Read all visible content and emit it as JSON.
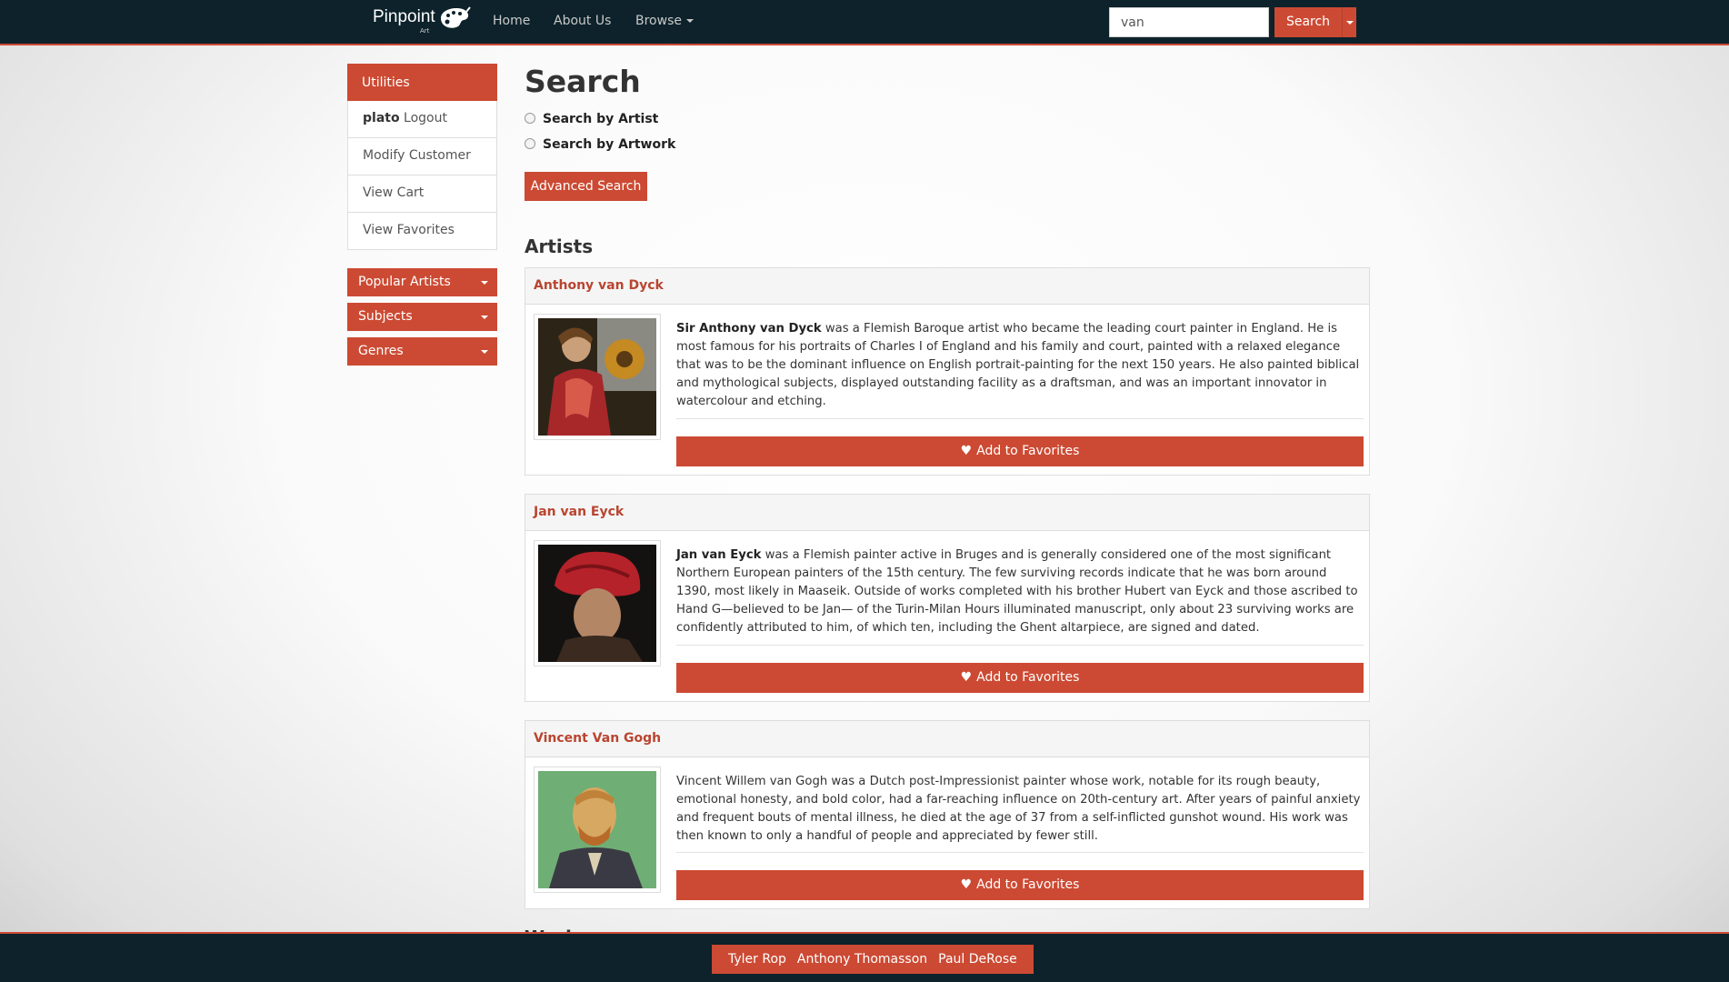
{
  "navbar": {
    "brand": "Pinpoint",
    "brand_sub": "Art",
    "links": [
      "Home",
      "About Us",
      "Browse"
    ],
    "search_value": "van",
    "search_button": "Search"
  },
  "sidebar": {
    "utilities_label": "Utilities",
    "user_name": "plato",
    "logout_label": "Logout",
    "items": [
      "Modify Customer",
      "View Cart",
      "View Favorites"
    ],
    "dropdowns": [
      "Popular Artists",
      "Subjects",
      "Genres"
    ]
  },
  "main": {
    "title": "Search",
    "radios": [
      "Search by Artist",
      "Search by Artwork"
    ],
    "advanced_button": "Advanced Search",
    "artists_heading": "Artists",
    "next_heading": "Works",
    "favorite_label": "Add to Favorites",
    "artists": [
      {
        "name": "Anthony van Dyck",
        "bold": "Sir Anthony van Dyck",
        "text": " was a Flemish Baroque artist who became the leading court painter in England. He is most famous for his portraits of Charles I of England and his family and court, painted with a relaxed elegance that was to be the dominant influence on English portrait-painting for the next 150 years. He also painted biblical and mythological subjects, displayed outstanding facility as a draftsman, and was an important innovator in watercolour and etching."
      },
      {
        "name": "Jan van Eyck",
        "bold": "Jan van Eyck",
        "text": " was a Flemish painter active in Bruges and is generally considered one of the most significant Northern European painters of the 15th century. The few surviving records indicate that he was born around 1390, most likely in Maaseik. Outside of works completed with his brother Hubert van Eyck and those ascribed to Hand G—believed to be Jan— of the Turin-Milan Hours illuminated manuscript, only about 23 surviving works are confidently attributed to him, of which ten, including the Ghent altarpiece, are signed and dated."
      },
      {
        "name": "Vincent Van Gogh",
        "bold": "",
        "text": "Vincent Willem van Gogh was a Dutch post-Impressionist painter whose work, notable for its rough beauty, emotional honesty, and bold color, had a far-reaching influence on 20th-century art. After years of painful anxiety and frequent bouts of mental illness, he died at the age of 37 from a self-inflicted gunshot wound. His work was then known to only a handful of people and appreciated by fewer still."
      }
    ]
  },
  "footer": {
    "names": [
      "Tyler Rop",
      "Anthony Thomasson",
      "Paul DeRose"
    ]
  },
  "colors": {
    "accent": "#cc4a33",
    "navbar": "#0d222b"
  }
}
